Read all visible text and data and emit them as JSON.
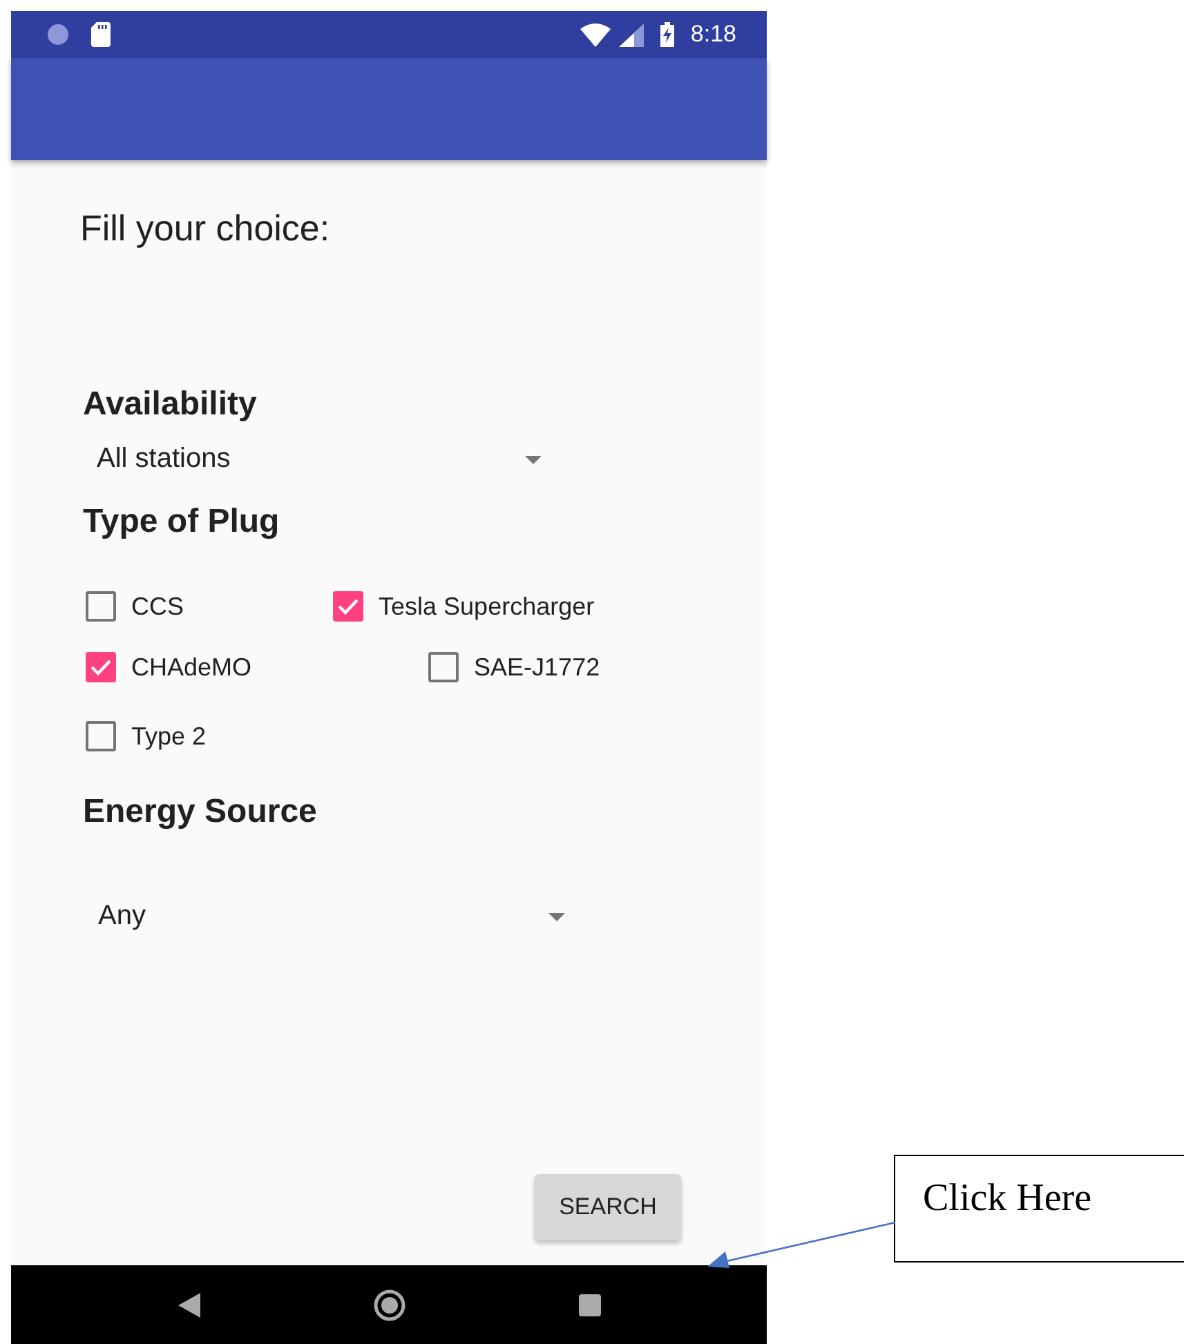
{
  "status_bar": {
    "time": "8:18"
  },
  "heading": "Fill your choice:",
  "availability": {
    "label": "Availability",
    "value": "All stations"
  },
  "plug_type": {
    "label": "Type of Plug",
    "rows": [
      {
        "options": [
          {
            "label": "CCS",
            "checked": false
          },
          {
            "label": "Tesla Supercharger",
            "checked": true
          }
        ]
      },
      {
        "options": [
          {
            "label": "CHAdeMO",
            "checked": true
          },
          {
            "label": "SAE-J1772",
            "checked": false
          }
        ]
      },
      {
        "options": [
          {
            "label": "Type 2",
            "checked": false
          }
        ]
      }
    ]
  },
  "energy_source": {
    "label": "Energy Source",
    "value": "Any"
  },
  "search_button": "SEARCH",
  "annotation": {
    "text": "Click Here"
  }
}
